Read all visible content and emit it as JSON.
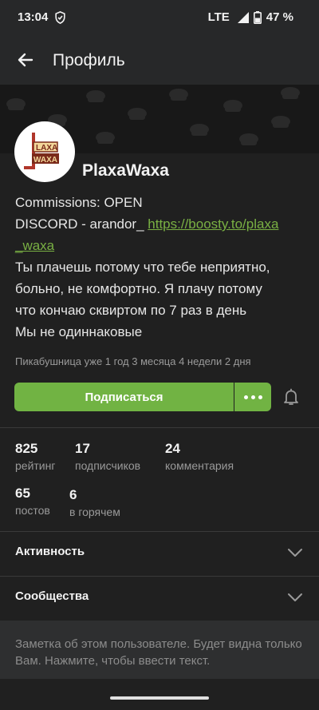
{
  "status_bar": {
    "time": "13:04",
    "network": "LTE",
    "battery": "47 %"
  },
  "app_bar": {
    "title": "Профиль"
  },
  "profile": {
    "username": "PlaxaWaxa",
    "avatar_logo_text": "LAXA WAXA",
    "bio": {
      "line1": "Commissions: OPEN",
      "line2_prefix": "DISCORD - arandor_ ",
      "line2_link": "https://boosty.to/plaxa",
      "line3_link": "_waxa",
      "line4": "Ты плачешь потому что тебе неприятно,",
      "line5": "больно, не комфортно. Я плачу потому",
      "line6": "что кончаю сквиртом по 7 раз в день",
      "line7": "Мы не одиннаковые"
    },
    "member_since": "Пикабушница уже 1 год 3 месяца 4 недели 2 дня"
  },
  "actions": {
    "subscribe_label": "Подписаться"
  },
  "stats": [
    {
      "value": "825",
      "label": "рейтинг"
    },
    {
      "value": "17",
      "label": "подписчиков"
    },
    {
      "value": "24",
      "label": "комментария"
    },
    {
      "value": "65",
      "label": "постов"
    },
    {
      "value": "6",
      "label": "в горячем"
    }
  ],
  "sections": [
    {
      "label": "Активность"
    },
    {
      "label": "Сообщества"
    }
  ],
  "note": {
    "text": "Заметка об этом пользователе. Будет видна только Вам. Нажмите, чтобы ввести текст."
  },
  "colors": {
    "accent": "#71b343",
    "link": "#79b043",
    "background": "#202020"
  }
}
